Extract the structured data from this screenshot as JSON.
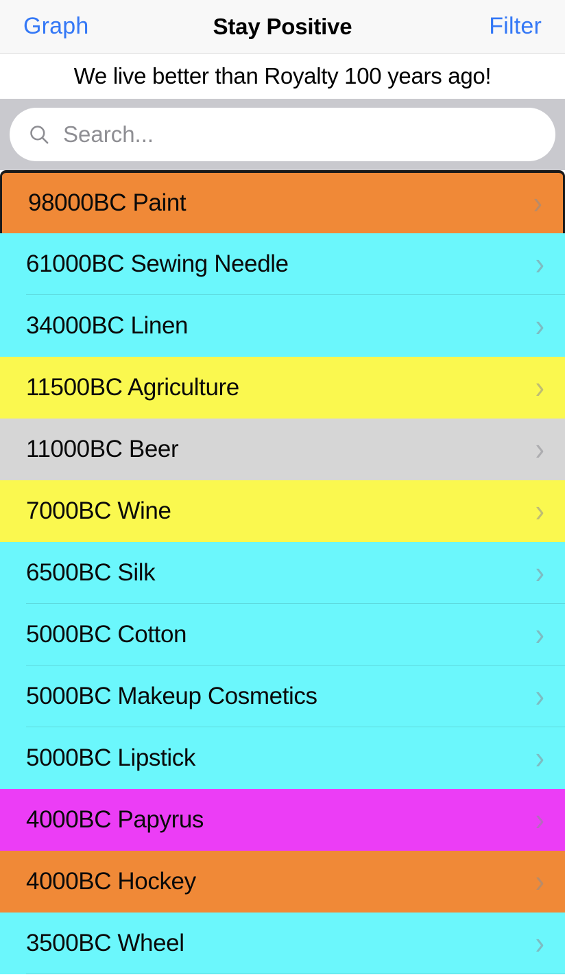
{
  "nav": {
    "left_button": "Graph",
    "title": "Stay Positive",
    "right_button": "Filter"
  },
  "subtitle": "We live better than Royalty 100 years ago!",
  "search": {
    "value": "",
    "placeholder": "Search...",
    "icon": "search-icon"
  },
  "colors": {
    "accent_blue": "#3478f6",
    "orange": "#f08937",
    "cyan": "#6bf7fc",
    "yellow": "#faf84f",
    "gray": "#d6d6d6",
    "magenta": "#ec3df6",
    "search_bar_bg": "#c9c9ce",
    "navbar_bg": "#f8f8f8"
  },
  "list": {
    "chevron_glyph": "›",
    "items": [
      {
        "label": "98000BC Paint",
        "color": "#f08937",
        "selected": true,
        "separator": false
      },
      {
        "label": "61000BC Sewing Needle",
        "color": "#6bf7fc",
        "selected": false,
        "separator": true
      },
      {
        "label": "34000BC Linen",
        "color": "#6bf7fc",
        "selected": false,
        "separator": false
      },
      {
        "label": "11500BC Agriculture",
        "color": "#faf84f",
        "selected": false,
        "separator": false
      },
      {
        "label": "11000BC Beer",
        "color": "#d6d6d6",
        "selected": false,
        "separator": false
      },
      {
        "label": "7000BC Wine",
        "color": "#faf84f",
        "selected": false,
        "separator": false
      },
      {
        "label": "6500BC Silk",
        "color": "#6bf7fc",
        "selected": false,
        "separator": true
      },
      {
        "label": "5000BC Cotton",
        "color": "#6bf7fc",
        "selected": false,
        "separator": true
      },
      {
        "label": "5000BC Makeup Cosmetics",
        "color": "#6bf7fc",
        "selected": false,
        "separator": true
      },
      {
        "label": "5000BC Lipstick",
        "color": "#6bf7fc",
        "selected": false,
        "separator": false
      },
      {
        "label": "4000BC Papyrus",
        "color": "#ec3df6",
        "selected": false,
        "separator": false
      },
      {
        "label": "4000BC Hockey",
        "color": "#f08937",
        "selected": false,
        "separator": false
      },
      {
        "label": "3500BC Wheel",
        "color": "#6bf7fc",
        "selected": false,
        "separator": true
      }
    ]
  }
}
